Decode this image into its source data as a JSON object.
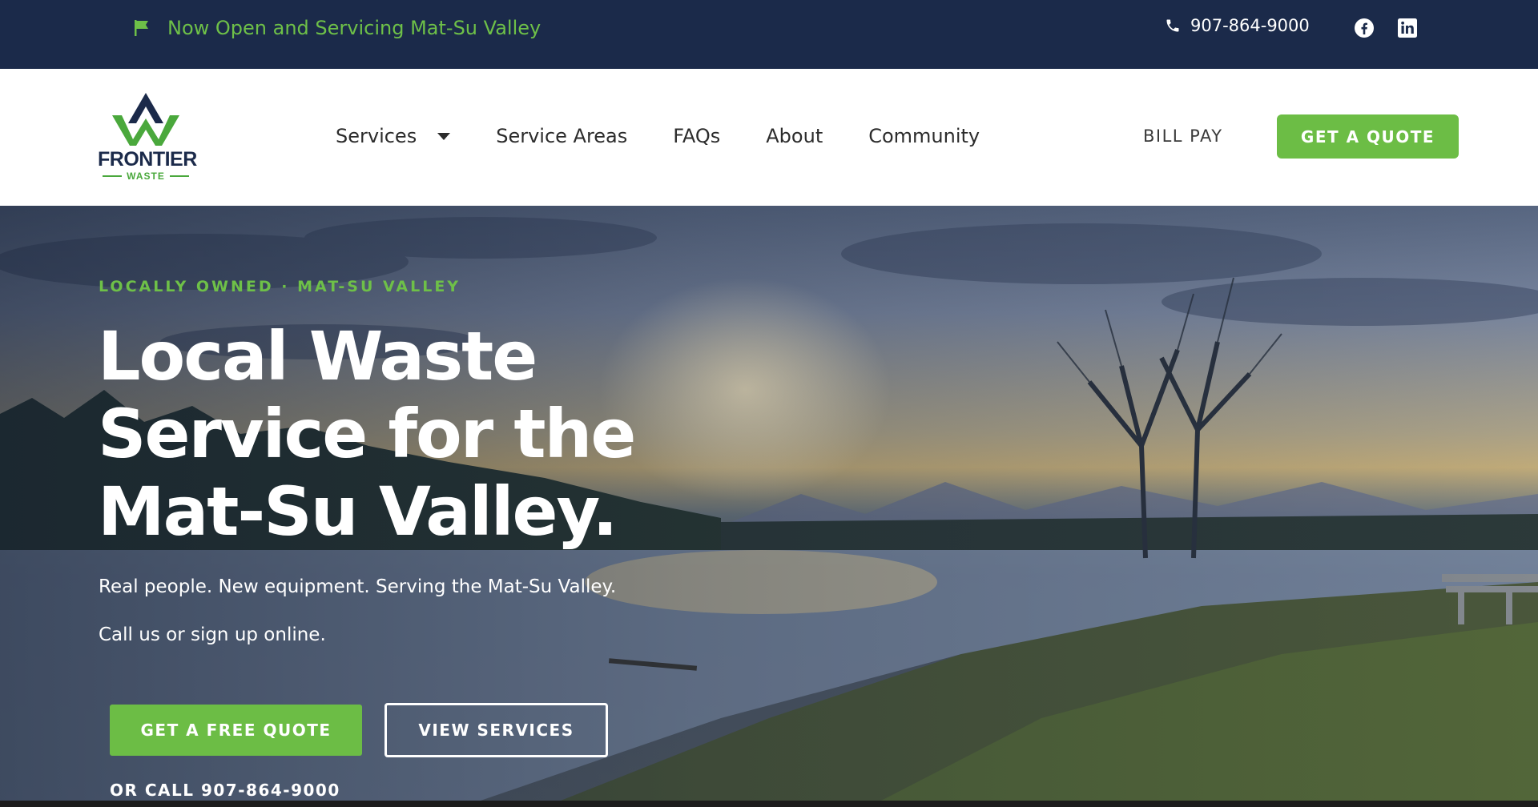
{
  "topbar": {
    "announcement": "Now Open and Servicing Mat-Su Valley",
    "phone": "907-864-9000",
    "icons": [
      "flag-icon",
      "phone-icon",
      "facebook-icon",
      "linkedin-icon"
    ]
  },
  "nav": {
    "logo_text": "FRONTIER",
    "logo_sub": "WASTE",
    "items": [
      {
        "label": "Services",
        "has_dropdown": true
      },
      {
        "label": "Service Areas"
      },
      {
        "label": "FAQs"
      },
      {
        "label": "About"
      },
      {
        "label": "Community"
      }
    ],
    "bill_pay": "BILL PAY",
    "cta": "GET A QUOTE"
  },
  "hero": {
    "eyebrow": "LOCALLY OWNED · MAT-SU VALLEY",
    "headline_lines": [
      "Local Waste",
      "Service for the",
      "Mat-Su Valley."
    ],
    "subtext_1": "Real people. New equipment. Serving the Mat-Su Valley.",
    "subtext_2": "Call us or sign up online.",
    "primary_button": "GET A FREE QUOTE",
    "secondary_button": "VIEW SERVICES",
    "call_text": "OR CALL 907-864-9000"
  },
  "colors": {
    "navy": "#1b2a4a",
    "green": "#6cbd45",
    "white": "#ffffff"
  }
}
